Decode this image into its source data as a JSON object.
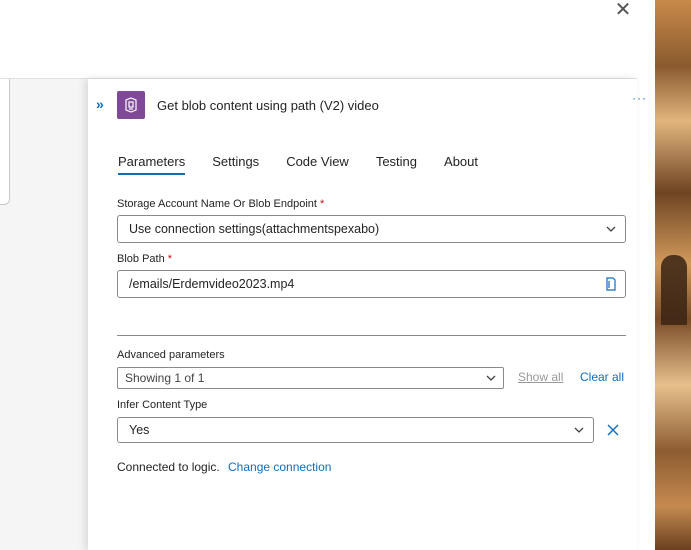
{
  "window": {
    "close_glyph": "✕"
  },
  "header": {
    "expand_glyph": "»",
    "title": "Get blob content using path (V2) video",
    "more_glyph": "···",
    "icon": "blob-storage-icon",
    "icon_color": "#804998"
  },
  "tabs": [
    {
      "label": "Parameters",
      "active": true
    },
    {
      "label": "Settings",
      "active": false
    },
    {
      "label": "Code View",
      "active": false
    },
    {
      "label": "Testing",
      "active": false
    },
    {
      "label": "About",
      "active": false
    }
  ],
  "fields": {
    "storage_account": {
      "label": "Storage Account Name Or Blob Endpoint",
      "required_mark": "*",
      "value": "Use connection settings(attachmentspexabo)"
    },
    "blob_path": {
      "label": "Blob Path",
      "required_mark": "*",
      "value": "/emails/Erdemvideo2023.mp4"
    }
  },
  "advanced": {
    "label": "Advanced parameters",
    "value": "Showing 1 of 1",
    "show_all": "Show all",
    "clear_all": "Clear all"
  },
  "infer_content_type": {
    "label": "Infer Content Type",
    "value": "Yes"
  },
  "connection": {
    "text": "Connected to logic.",
    "link": "Change connection"
  },
  "colors": {
    "accent": "#0f6cbd",
    "required": "#c50f1f"
  }
}
